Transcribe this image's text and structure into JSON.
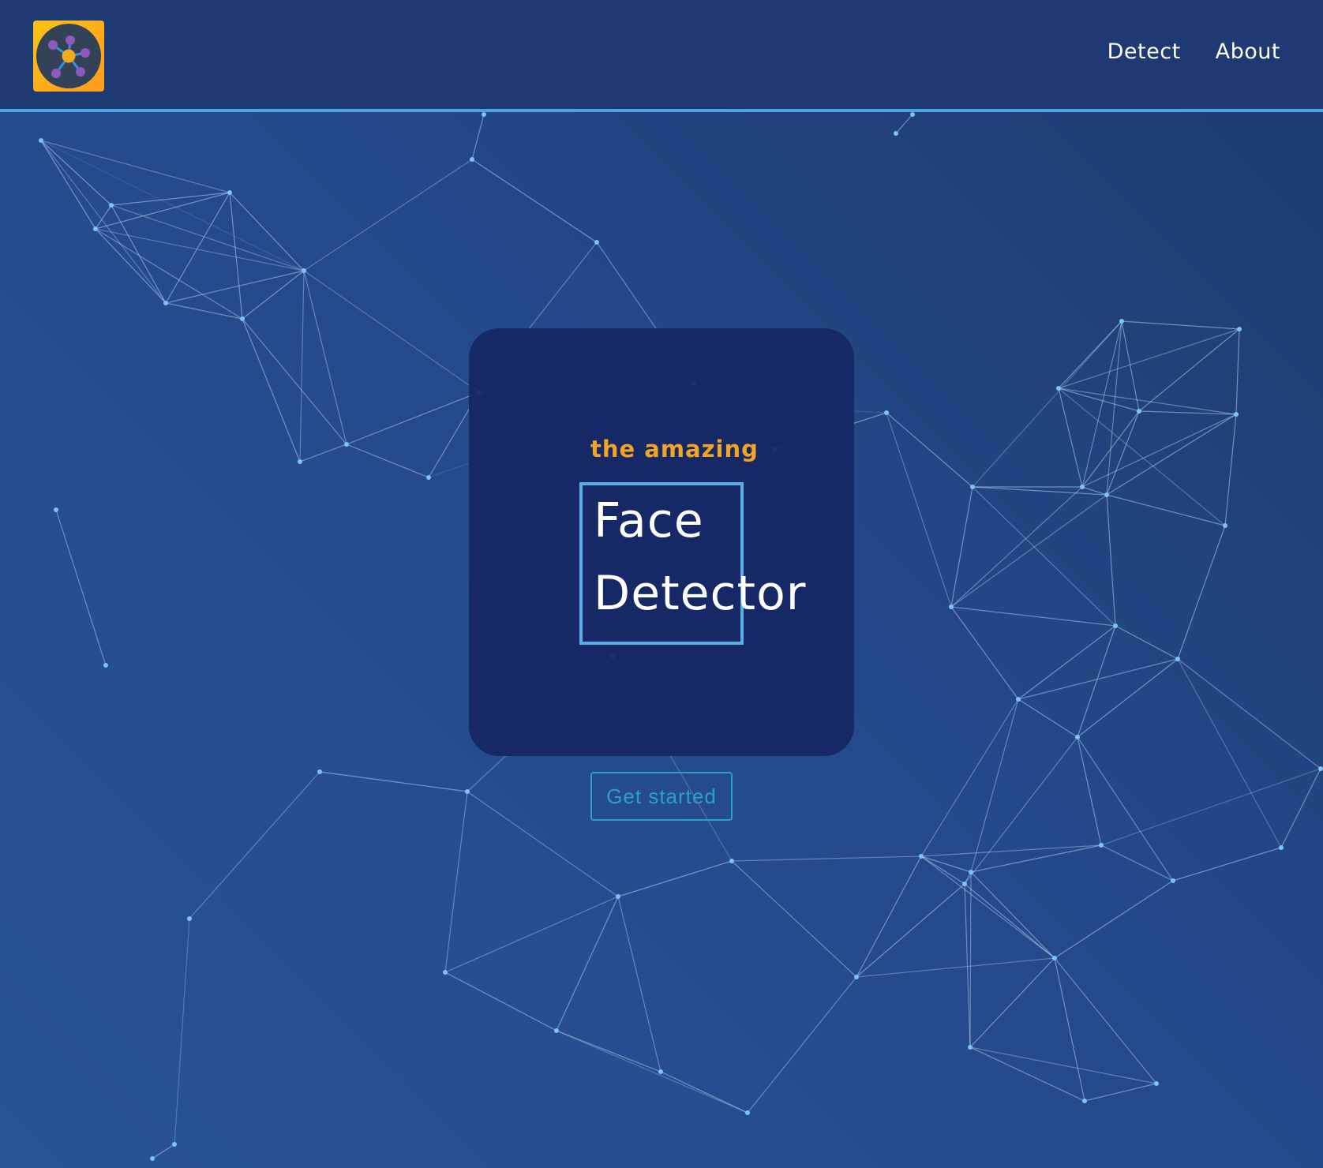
{
  "nav": {
    "logo_icon": "network-icon",
    "links": [
      {
        "label": "Detect"
      },
      {
        "label": "About"
      }
    ]
  },
  "hero": {
    "subtitle": "the amazing",
    "title_line1": "Face",
    "title_line2": "Detector",
    "cta_label": "Get started"
  },
  "colors": {
    "accent": "#f2a423",
    "frame": "#5aaee6",
    "cta": "#2aa0c4",
    "navbar": "#1f3a72",
    "card": "#162663",
    "particle": "#7cc4f2"
  }
}
